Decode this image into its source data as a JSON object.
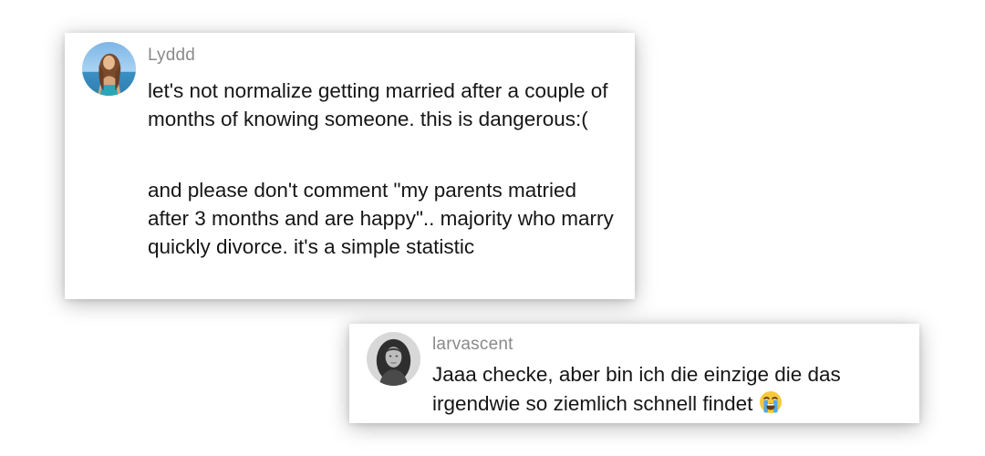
{
  "comments": [
    {
      "username": "Lyddd",
      "avatar_icon": "profile-photo-beach-woman",
      "paragraphs": [
        "let's not normalize getting married after a couple of months of knowing someone. this is dangerous:(",
        "and please don't comment \"my parents matried after 3 months and are happy\".. majority who marry quickly divorce. it's a simple statistic"
      ]
    },
    {
      "username": "larvascent",
      "avatar_icon": "profile-photo-grayscale-woman",
      "text": "Jaaa checke, aber bin ich die einzige die das irgendwie so ziemlich schnell findet",
      "emoji_icon": "loudly-crying-face-emoji"
    }
  ],
  "colors": {
    "username": "#8a8a8a",
    "text": "#161616",
    "card_background": "#ffffff"
  }
}
